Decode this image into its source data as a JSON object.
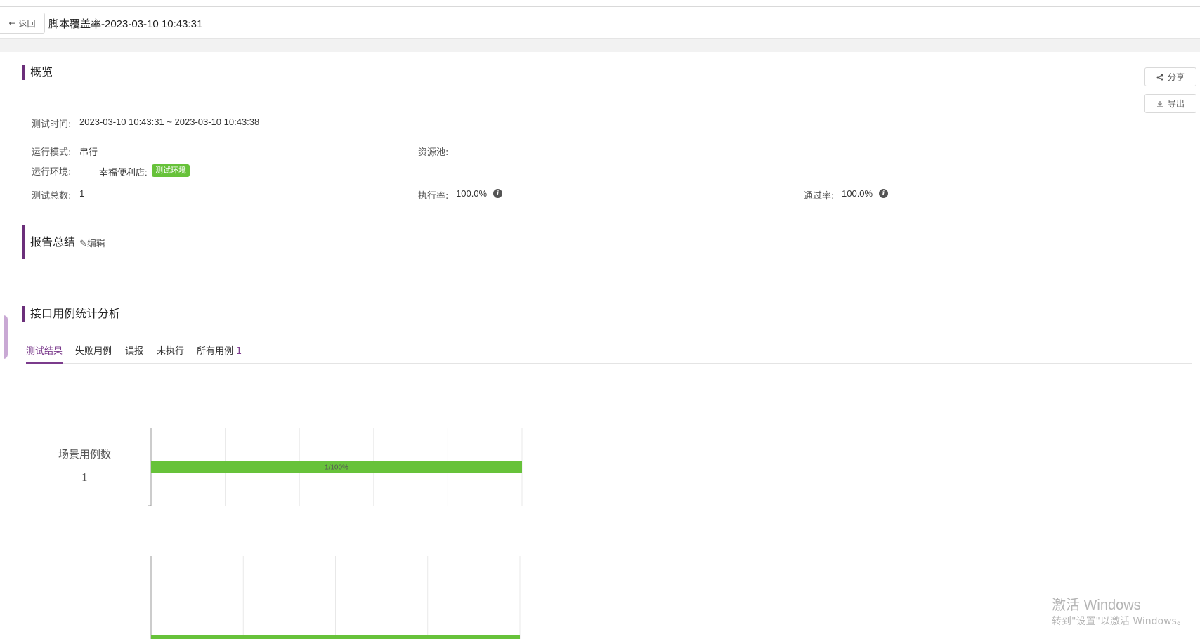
{
  "header": {
    "back_label": "返回",
    "back_arrow": "←",
    "title": "脚本覆盖率-2023-03-10 10:43:31"
  },
  "actions": {
    "share_label": "分享",
    "export_label": "导出"
  },
  "overview": {
    "section_title": "概览",
    "test_time_label": "测试时间:",
    "test_time_value": "2023-03-10 10:43:31 ~ 2023-03-10 10:43:38",
    "run_mode_label": "运行模式:",
    "run_mode_value": "串行",
    "resource_pool_label": "资源池:",
    "run_env_label": "运行环境:",
    "run_env_value": "幸福便利店:",
    "run_env_tag": "测试环境",
    "total_label": "测试总数:",
    "total_value": "1",
    "exec_rate_label": "执行率:",
    "exec_rate_value": "100.0%",
    "pass_rate_label": "通过率:",
    "pass_rate_value": "100.0%"
  },
  "summary": {
    "section_title": "报告总结",
    "edit_label": "✎编辑"
  },
  "analysis": {
    "section_title": "接口用例统计分析",
    "tabs": [
      {
        "label": "测试结果"
      },
      {
        "label": "失败用例"
      },
      {
        "label": "误报"
      },
      {
        "label": "未执行"
      },
      {
        "label": "所有用例",
        "count": "1"
      }
    ]
  },
  "colors": {
    "accent": "#7b3b8c",
    "success": "#67c23a"
  },
  "chart_data": [
    {
      "type": "bar",
      "orientation": "horizontal",
      "side_label": "场景用例数",
      "side_value": "1",
      "categories": [
        ""
      ],
      "values": [
        1
      ],
      "data_label": "1/100%",
      "xlim": [
        0,
        1
      ],
      "xticks": [
        "0",
        "0.2",
        "0.4",
        "0.6",
        "0.8",
        "1"
      ],
      "grid": true,
      "color": "#67c23a"
    },
    {
      "type": "bar",
      "orientation": "horizontal",
      "values": [
        1
      ],
      "grid": true,
      "color": "#67c23a",
      "note": "partially visible, cropped at bottom"
    }
  ],
  "watermark": {
    "line1": "激活 Windows",
    "line2": "转到\"设置\"以激活 Windows。"
  }
}
